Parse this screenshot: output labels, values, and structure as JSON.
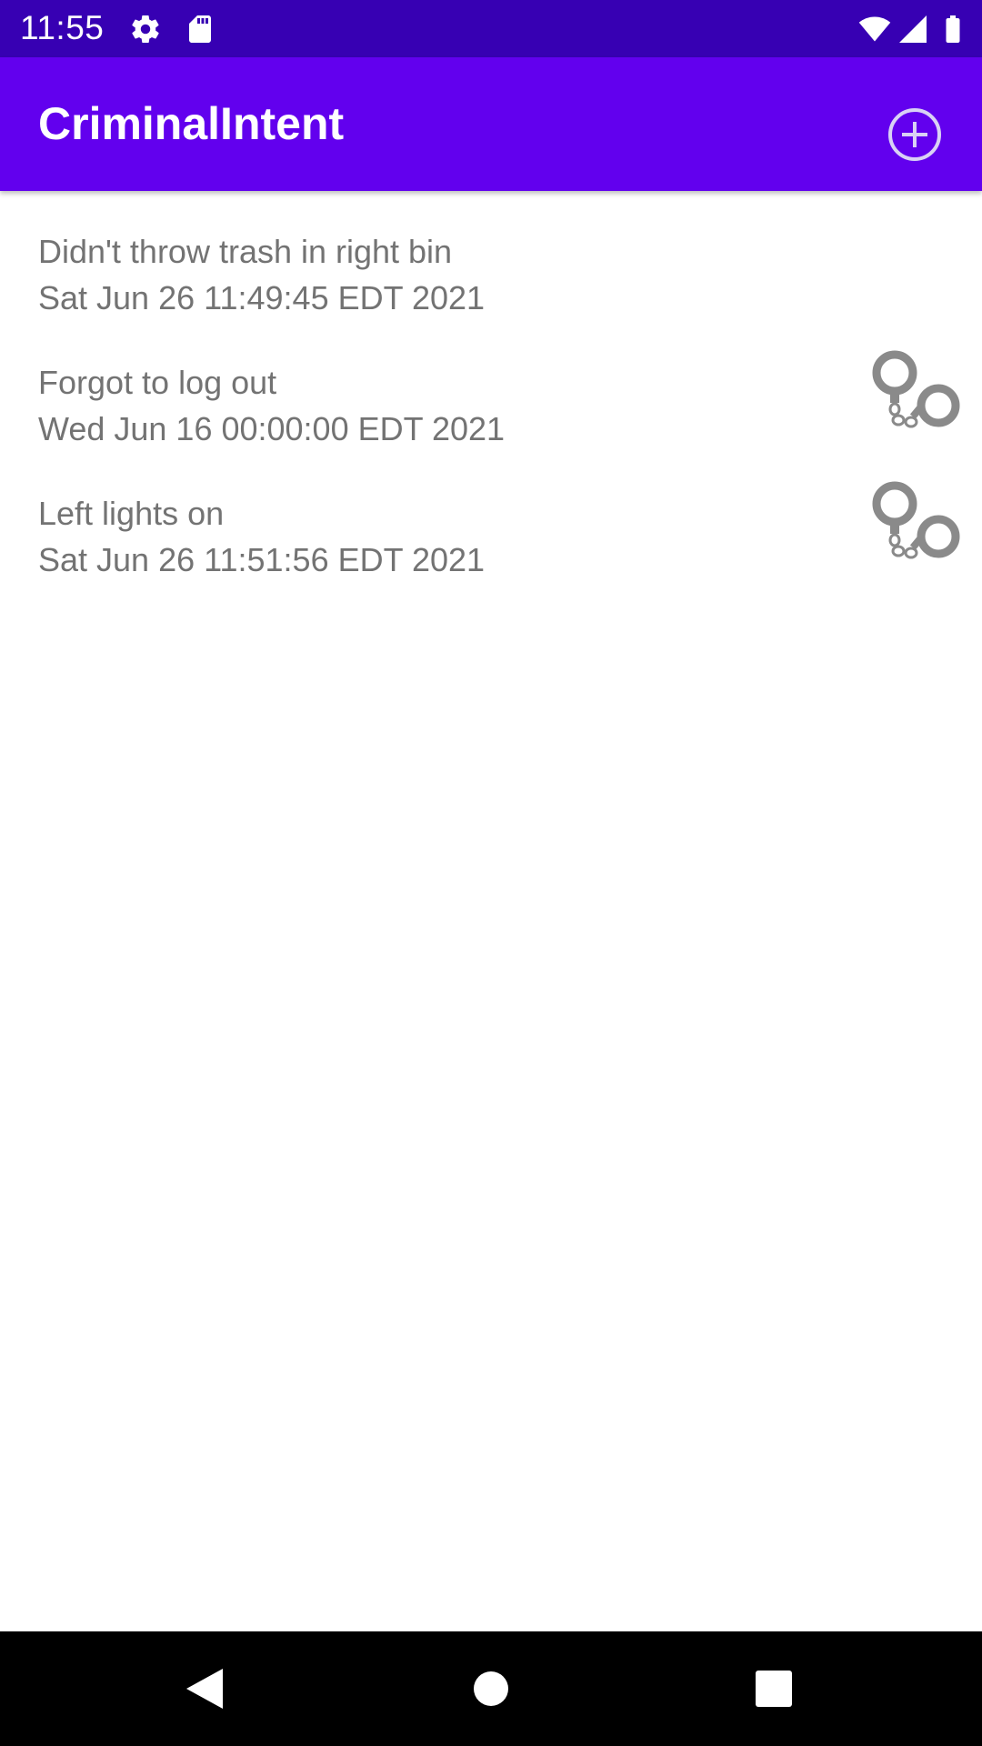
{
  "status_bar": {
    "time": "11:55",
    "icons": [
      "settings-icon",
      "sd-card-icon",
      "wifi-icon",
      "signal-icon",
      "battery-icon"
    ]
  },
  "app_bar": {
    "title": "CriminalIntent",
    "add_icon": "add-circle-icon"
  },
  "crimes": [
    {
      "title": "Didn't throw trash in right bin",
      "date": "Sat Jun 26 11:49:45 EDT 2021",
      "solved": false
    },
    {
      "title": "Forgot to log out",
      "date": "Wed Jun 16 00:00:00 EDT 2021",
      "solved": true
    },
    {
      "title": "Left lights on",
      "date": "Sat Jun 26 11:51:56 EDT 2021",
      "solved": true
    }
  ],
  "nav_bar": {
    "icons": [
      "back-icon",
      "home-icon",
      "recents-icon"
    ]
  },
  "colors": {
    "status_bar": "#3700b3",
    "app_bar": "#6200ee",
    "text_secondary": "#737373",
    "icon_gray": "#8a8a8a"
  }
}
